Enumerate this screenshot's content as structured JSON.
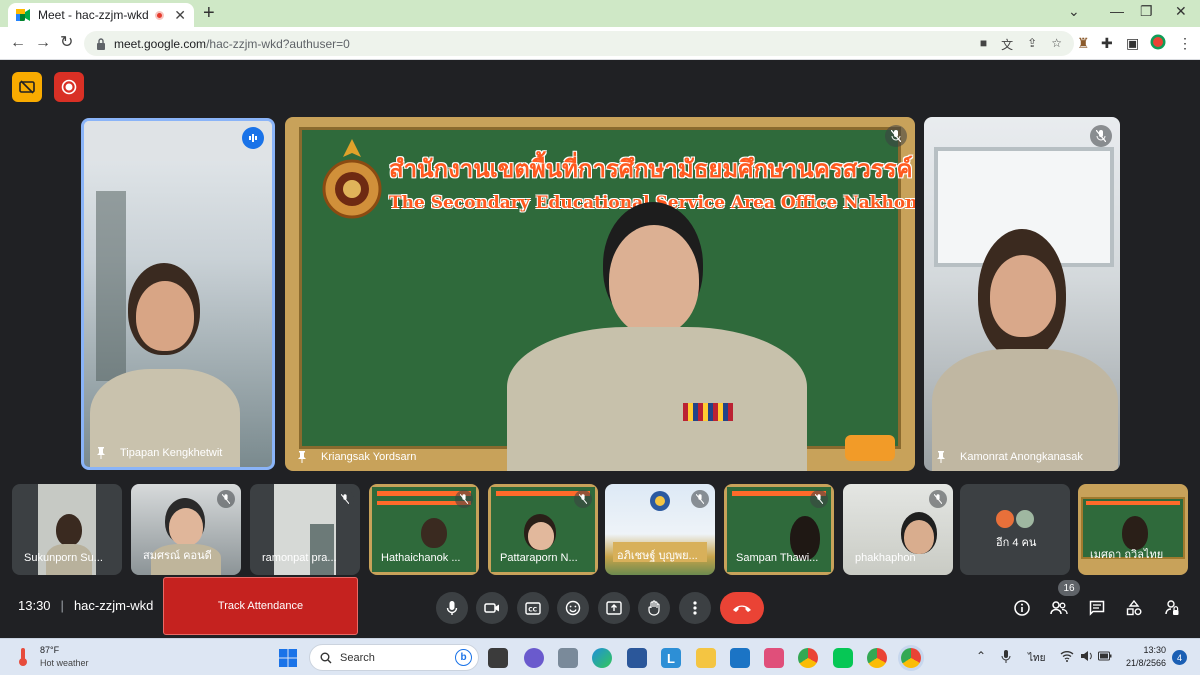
{
  "browser": {
    "tab_title": "Meet - hac-zzjm-wkd",
    "tab_close": "✕",
    "new_tab": "+",
    "url_host": "meet.google.com",
    "url_path": "/hac-zzjm-wkd?authuser=0",
    "win_minimize": "⌄",
    "win_min": "—",
    "win_restore": "❐",
    "win_close": "✕"
  },
  "meet": {
    "main_tiles": [
      {
        "name": "Tipapan Kengkhetwit"
      },
      {
        "name": "Kriangsak Yordsarn"
      },
      {
        "name": "Kamonrat Anongkanasak"
      }
    ],
    "banner": {
      "thai": "สำนักงานเขตพื้นที่การศึกษามัธยมศึกษานครสวรรค์",
      "english": "The Secondary Educational Service Area Office Nakhon Sawan"
    },
    "strip": [
      {
        "name": "Sukunporn Su..."
      },
      {
        "name": "สมศรณ์ คอนดี"
      },
      {
        "name": "ramonpat pra..."
      },
      {
        "name": "Hathaichanok ..."
      },
      {
        "name": "Pattaraporn N..."
      },
      {
        "name": "อภิเชษฐ์ บุญพย..."
      },
      {
        "name": "Sampan Thawi..."
      },
      {
        "name": "phakhaphon"
      },
      {
        "name": "อีก 4 คน"
      },
      {
        "name": "เมศดา ถวิลไทย"
      }
    ],
    "time": "13:30",
    "separator": "|",
    "meeting_code": "hac-zzjm-wkd",
    "track_attendance": "Track Attendance",
    "people_count": "16"
  },
  "taskbar": {
    "temp": "87°F",
    "weather": "Hot weather",
    "search": "Search",
    "lang": "ไทย",
    "clock_time": "13:30",
    "clock_date": "21/8/2566",
    "notif_count": "4"
  },
  "colors": {
    "meet_bg": "#202124",
    "accent_red": "#ea4335",
    "track_red": "#c5221f",
    "active_border": "#8ab4f8"
  }
}
